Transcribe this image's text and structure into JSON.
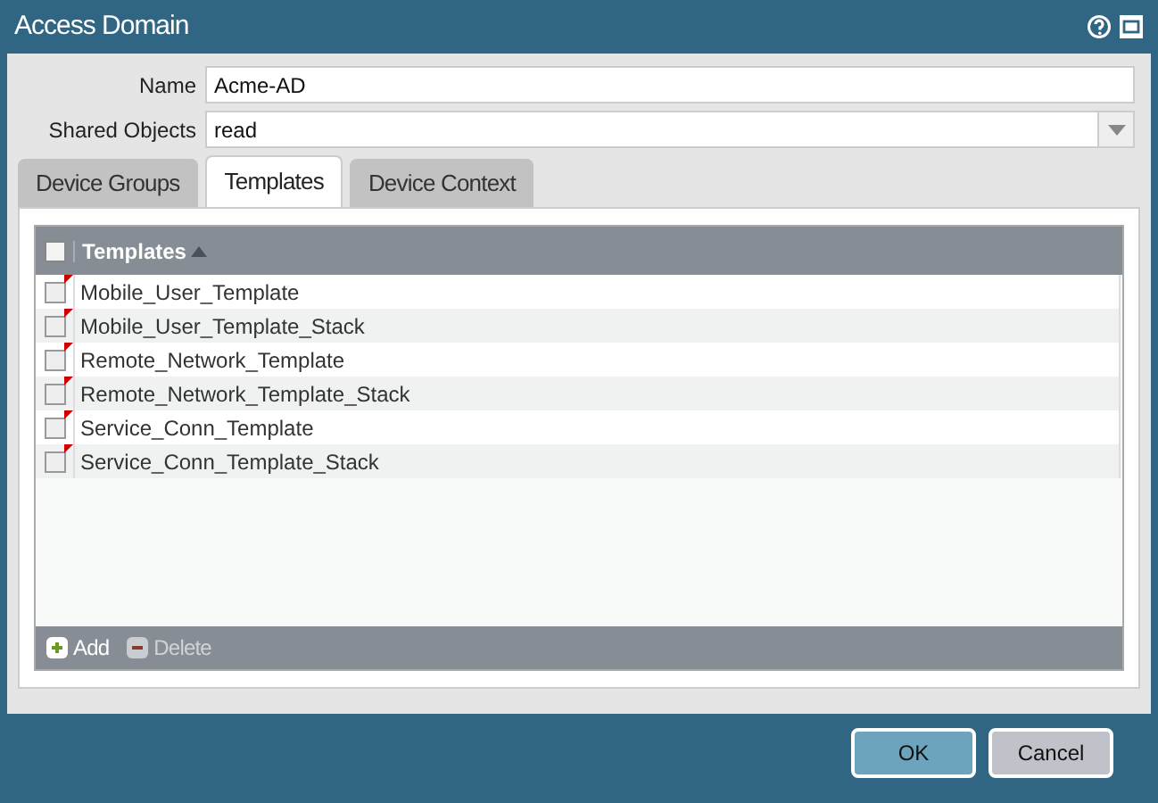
{
  "window": {
    "title": "Access Domain"
  },
  "fields": [
    {
      "label": "Name",
      "value": "Acme-AD",
      "kind": "text"
    },
    {
      "label": "Shared Objects",
      "value": "read",
      "kind": "select"
    }
  ],
  "tabs": [
    {
      "label": "Device Groups",
      "selected": false
    },
    {
      "label": "Templates",
      "selected": true
    },
    {
      "label": "Device Context",
      "selected": false
    }
  ],
  "table": {
    "header_checked": false,
    "columns": [
      {
        "label": "Templates",
        "sorted_ascending": true
      }
    ],
    "rows": [
      {
        "name": "Mobile_User_Template",
        "checked": false,
        "flagged": true
      },
      {
        "name": "Mobile_User_Template_Stack",
        "checked": false,
        "flagged": true
      },
      {
        "name": "Remote_Network_Template",
        "checked": false,
        "flagged": true
      },
      {
        "name": "Remote_Network_Template_Stack",
        "checked": false,
        "flagged": true
      },
      {
        "name": "Service_Conn_Template",
        "checked": false,
        "flagged": true
      },
      {
        "name": "Service_Conn_Template_Stack",
        "checked": false,
        "flagged": true
      }
    ]
  },
  "toolbar": [
    {
      "label": "Add",
      "kind": "add",
      "disabled": false
    },
    {
      "label": "Delete",
      "kind": "delete",
      "disabled": true
    }
  ],
  "buttons": [
    {
      "label": "OK",
      "kind": "primary"
    },
    {
      "label": "Cancel",
      "kind": "secondary"
    }
  ]
}
